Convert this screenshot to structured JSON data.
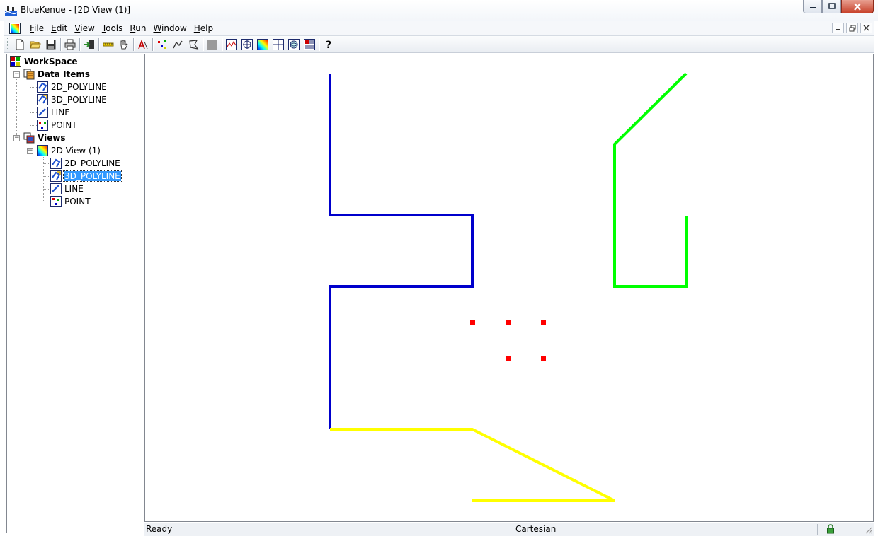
{
  "window": {
    "title": "BlueKenue - [2D View (1)]",
    "buttons": [
      "minimize",
      "maximize",
      "close"
    ]
  },
  "menubar": {
    "items": [
      {
        "label": "File",
        "mnemonic": "F",
        "rest": "ile"
      },
      {
        "label": "Edit",
        "mnemonic": "E",
        "rest": "dit"
      },
      {
        "label": "View",
        "mnemonic": "V",
        "rest": "iew"
      },
      {
        "label": "Tools",
        "mnemonic": "T",
        "rest": "ools"
      },
      {
        "label": "Run",
        "mnemonic": "R",
        "rest": "un"
      },
      {
        "label": "Window",
        "mnemonic": "W",
        "rest": "indow"
      },
      {
        "label": "Help",
        "mnemonic": "H",
        "rest": "elp"
      }
    ]
  },
  "toolbar": {
    "icons": [
      "new-file-icon",
      "open-folder-icon",
      "save-icon",
      "print-icon",
      "import-icon",
      "measure-ruler-icon",
      "pan-hand-icon",
      "text-annotation-icon",
      "points-icon",
      "polyline-icon",
      "polygon-icon",
      "disabled-icon",
      "profile-view-icon",
      "target-view-icon",
      "2d-view-icon",
      "grid-view-icon",
      "3d-view-icon",
      "table-view-icon",
      "help-icon"
    ]
  },
  "tree": {
    "root": {
      "label": "WorkSpace"
    },
    "data_items": {
      "label": "Data Items",
      "children": [
        "2D_POLYLINE",
        "3D_POLYLINE",
        "LINE",
        "POINT"
      ]
    },
    "views": {
      "label": "Views",
      "view": {
        "label": "2D View (1)",
        "children": [
          "2D_POLYLINE",
          "3D_POLYLINE",
          "LINE",
          "POINT"
        ],
        "selected_index": 1
      }
    }
  },
  "view": {
    "colors": {
      "blue_polyline": "#0000cc",
      "green_polyline": "#00ff00",
      "yellow_line": "#ffff00",
      "red_points": "#ff0000"
    }
  },
  "statusbar": {
    "message": "Ready",
    "coordinate_system": "Cartesian"
  }
}
